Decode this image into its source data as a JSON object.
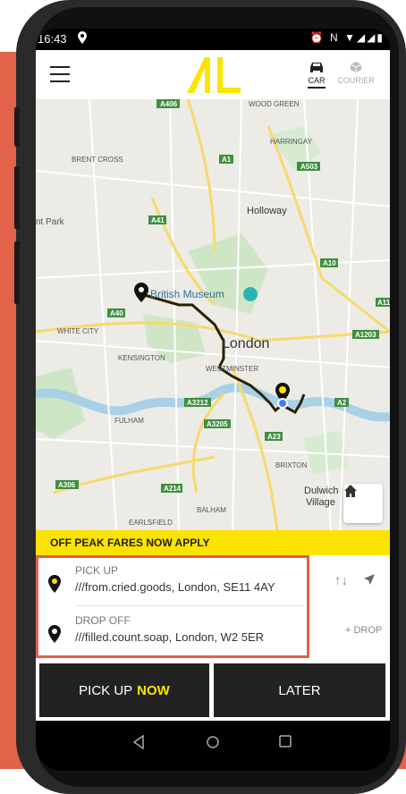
{
  "status_bar": {
    "time": "16:43",
    "right_icons": "⏰ N ▼◢◢▮"
  },
  "header": {
    "modes": [
      {
        "label": "CAR",
        "icon": "car-icon",
        "active": true
      },
      {
        "label": "COURIER",
        "icon": "package-icon",
        "active": false
      }
    ]
  },
  "map": {
    "place_labels": [
      "WOOD GREEN",
      "HARRINGAY",
      "BRENT CROSS",
      "Holloway",
      "nt Park",
      "British Museum",
      "WHITE CITY",
      "London",
      "KENSINGTON",
      "WESTMINSTER",
      "FULHAM",
      "BRIXTON",
      "Dulwich",
      "Village",
      "BALHAM",
      "EARLSFIELD"
    ],
    "road_labels": [
      "A406",
      "A1",
      "A503",
      "A41",
      "A10",
      "A40",
      "A1203",
      "A3212",
      "A3205",
      "A2",
      "A23",
      "A306",
      "A214",
      "A11"
    ]
  },
  "banner": {
    "text": "OFF PEAK FARES NOW APPLY"
  },
  "pickup": {
    "label": "PICK UP",
    "address": "///from.cried.goods, London, SE11 4AY"
  },
  "dropoff": {
    "label": "DROP OFF",
    "address": "///filled.count.soap, London, W2 5ER"
  },
  "side_actions": {
    "swap": "↑↓",
    "add_drop": "+ DROP"
  },
  "buttons": {
    "pickup_prefix": "PICK UP",
    "pickup_accent": "NOW",
    "later": "LATER"
  },
  "colors": {
    "accent": "#fde400",
    "highlight": "#e2624a",
    "dark": "#222222"
  }
}
